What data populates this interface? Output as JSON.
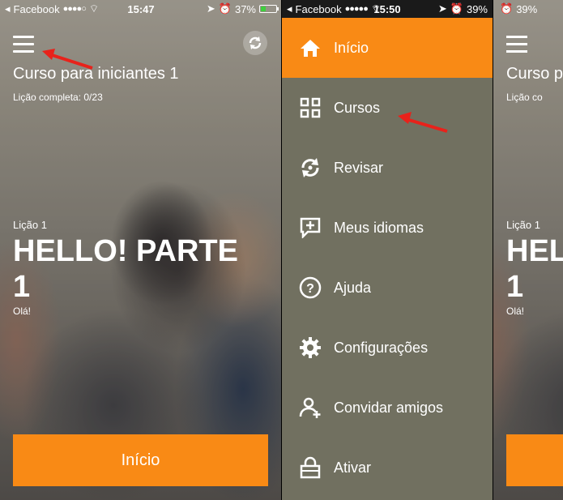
{
  "status_left": {
    "carrier": "Facebook",
    "time": "15:47",
    "battery": "37%"
  },
  "status_mid": {
    "carrier": "Facebook",
    "time": "15:50",
    "battery": "39%"
  },
  "status_right": {
    "battery": "39%"
  },
  "course": {
    "title": "Curso para iniciantes 1",
    "progress": "Lição completa: 0/23"
  },
  "lesson": {
    "number": "Lição 1",
    "title": "HELLO! PARTE 1",
    "subtitle": "Olá!"
  },
  "start_button": "Início",
  "menu": {
    "items": [
      {
        "label": "Início",
        "icon": "home-icon"
      },
      {
        "label": "Cursos",
        "icon": "grid-icon"
      },
      {
        "label": "Revisar",
        "icon": "sync-icon"
      },
      {
        "label": "Meus idiomas",
        "icon": "add-language-icon"
      },
      {
        "label": "Ajuda",
        "icon": "help-icon"
      },
      {
        "label": "Configurações",
        "icon": "gear-icon"
      },
      {
        "label": "Convidar amigos",
        "icon": "add-user-icon"
      },
      {
        "label": "Ativar",
        "icon": "unlock-icon"
      }
    ]
  },
  "colors": {
    "accent": "#f98a15",
    "menu_bg": "#717060",
    "arrow": "#e8221b"
  },
  "right_peek": {
    "course_title": "Curso p",
    "progress": "Lição co",
    "lesson_number": "Lição 1",
    "lesson_title": "HEL",
    "lesson_title_line2": "1",
    "subtitle": "Olá!"
  }
}
